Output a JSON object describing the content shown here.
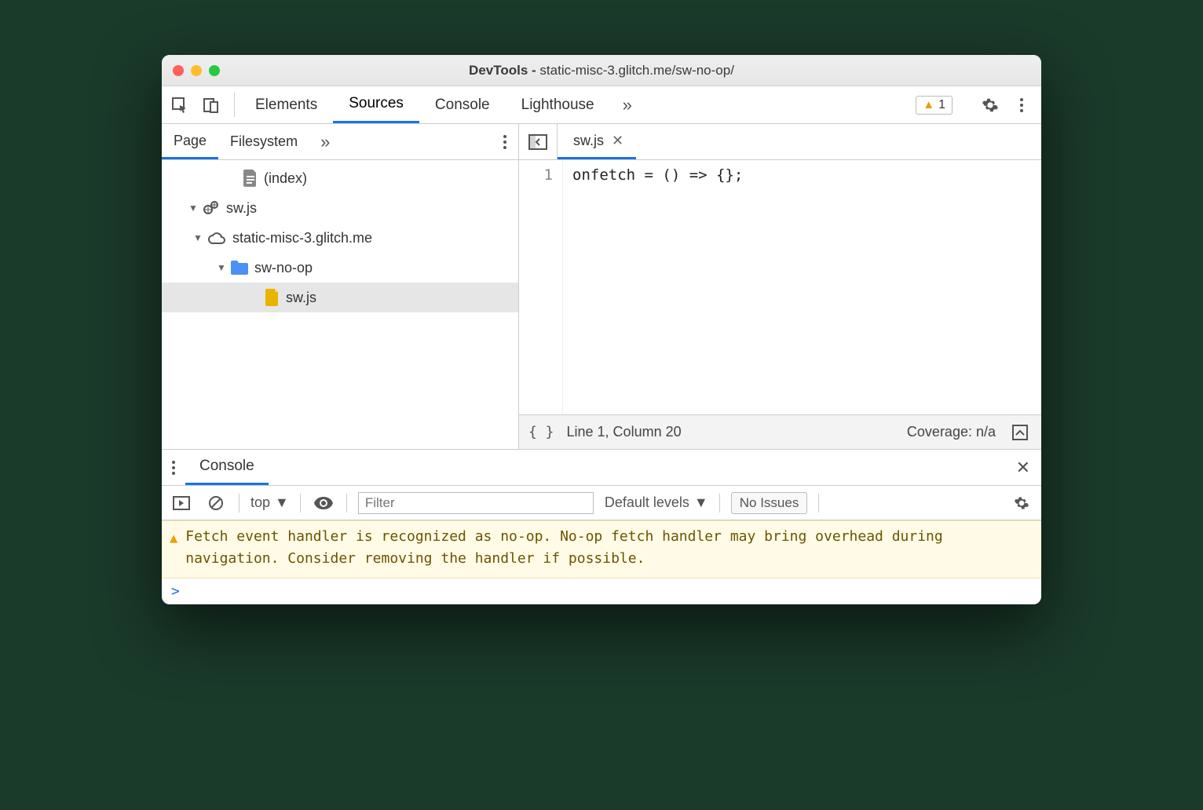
{
  "title": {
    "prefix": "DevTools - ",
    "url": "static-misc-3.glitch.me/sw-no-op/"
  },
  "mainTabs": [
    "Elements",
    "Sources",
    "Console",
    "Lighthouse"
  ],
  "mainActive": "Sources",
  "warningCount": "1",
  "leftTabs": {
    "active": "Page",
    "other": "Filesystem"
  },
  "tree": {
    "index": "(index)",
    "swjs": "sw.js",
    "domain": "static-misc-3.glitch.me",
    "folder": "sw-no-op",
    "file": "sw.js"
  },
  "editor": {
    "tab": "sw.js",
    "lineNum": "1",
    "code": "onfetch = () => {};"
  },
  "status": {
    "braces": "{ }",
    "cursor": "Line 1, Column 20",
    "coverage": "Coverage: n/a"
  },
  "console": {
    "tab": "Console",
    "context": "top",
    "filterPlaceholder": "Filter",
    "levels": "Default levels",
    "issues": "No Issues",
    "warning": "Fetch event handler is recognized as no-op. No-op fetch handler may bring overhead during navigation. Consider removing the handler if possible.",
    "prompt": ">"
  }
}
